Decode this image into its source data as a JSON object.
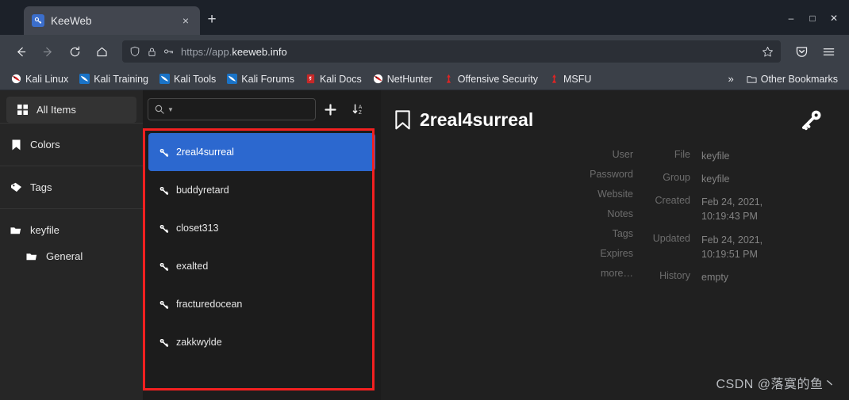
{
  "browser": {
    "tab": {
      "title": "KeeWeb",
      "favicon": "key-icon",
      "close": "×"
    },
    "new_tab_label": "+",
    "window_controls": {
      "minimize": "–",
      "maximize": "□",
      "close": "✕"
    },
    "nav": {
      "back": "←",
      "forward": "→",
      "reload": "↻",
      "home": "⌂"
    },
    "url": {
      "prefix": "https://app.",
      "domain": "keeweb.info",
      "full": "https://app.keeweb.info"
    },
    "toolbar_right": {
      "pocket": "pocket-icon",
      "menu": "☰"
    },
    "bookmarks": [
      {
        "label": "Kali Linux",
        "icon": "kali-dragon-icon",
        "color": "#d32222"
      },
      {
        "label": "Kali Training",
        "icon": "kali-blue-icon",
        "color": "#1a73c7"
      },
      {
        "label": "Kali Tools",
        "icon": "kali-blue-icon",
        "color": "#1a73c7"
      },
      {
        "label": "Kali Forums",
        "icon": "kali-blue-icon",
        "color": "#1a73c7"
      },
      {
        "label": "Kali Docs",
        "icon": "kali-docs-icon",
        "color": "#c62828"
      },
      {
        "label": "NetHunter",
        "icon": "nethunter-icon",
        "color": "#d32222"
      },
      {
        "label": "Offensive Security",
        "icon": "offsec-icon",
        "color": "#e02424"
      },
      {
        "label": "MSFU",
        "icon": "offsec-icon",
        "color": "#e02424"
      }
    ],
    "bookmarks_overflow": "»",
    "other_bookmarks": {
      "label": "Other Bookmarks",
      "icon": "folder-icon"
    }
  },
  "app": {
    "sidebar": [
      {
        "label": "All Items",
        "icon": "grid-icon",
        "selected": true
      },
      {
        "label": "Colors",
        "icon": "bookmark-icon",
        "selected": false
      },
      {
        "label": "Tags",
        "icon": "tag-icon",
        "selected": false
      },
      {
        "label": "keyfile",
        "icon": "folder-icon",
        "selected": false
      },
      {
        "label": "General",
        "icon": "folder-icon",
        "selected": false,
        "indent": true
      }
    ],
    "list_toolbar": {
      "search_placeholder": "",
      "search_value": "",
      "search_icon": "search-icon",
      "search_caret": "chevron-down-icon",
      "add_label": "+",
      "sort_label": "sort-icon"
    },
    "entries": [
      {
        "title": "2real4surreal",
        "icon": "key-icon",
        "selected": true
      },
      {
        "title": "buddyretard",
        "icon": "key-icon",
        "selected": false
      },
      {
        "title": "closet313",
        "icon": "key-icon",
        "selected": false
      },
      {
        "title": "exalted",
        "icon": "key-icon",
        "selected": false
      },
      {
        "title": "fracturedocean",
        "icon": "key-icon",
        "selected": false
      },
      {
        "title": "zakkwylde",
        "icon": "key-icon",
        "selected": false
      }
    ],
    "details": {
      "title": "2real4surreal",
      "title_icon": "bookmark-icon",
      "badge_icon": "key-icon",
      "left_fields": [
        {
          "label": "User",
          "value": ""
        },
        {
          "label": "Password",
          "value": ""
        },
        {
          "label": "Website",
          "value": ""
        },
        {
          "label": "Notes",
          "value": ""
        },
        {
          "label": "Tags",
          "value": ""
        },
        {
          "label": "Expires",
          "value": ""
        }
      ],
      "more_label": "more…",
      "right_fields": [
        {
          "label": "File",
          "value": "keyfile"
        },
        {
          "label": "Group",
          "value": "keyfile"
        },
        {
          "label": "Created",
          "value": "Feb 24, 2021, 10:19:43 PM"
        },
        {
          "label": "Updated",
          "value": "Feb 24, 2021, 10:19:51 PM"
        },
        {
          "label": "History",
          "value": "empty"
        }
      ]
    },
    "watermark": "CSDN @落寞的鱼丶",
    "annotation": {
      "type": "red-rectangle",
      "color": "#f32020"
    }
  }
}
